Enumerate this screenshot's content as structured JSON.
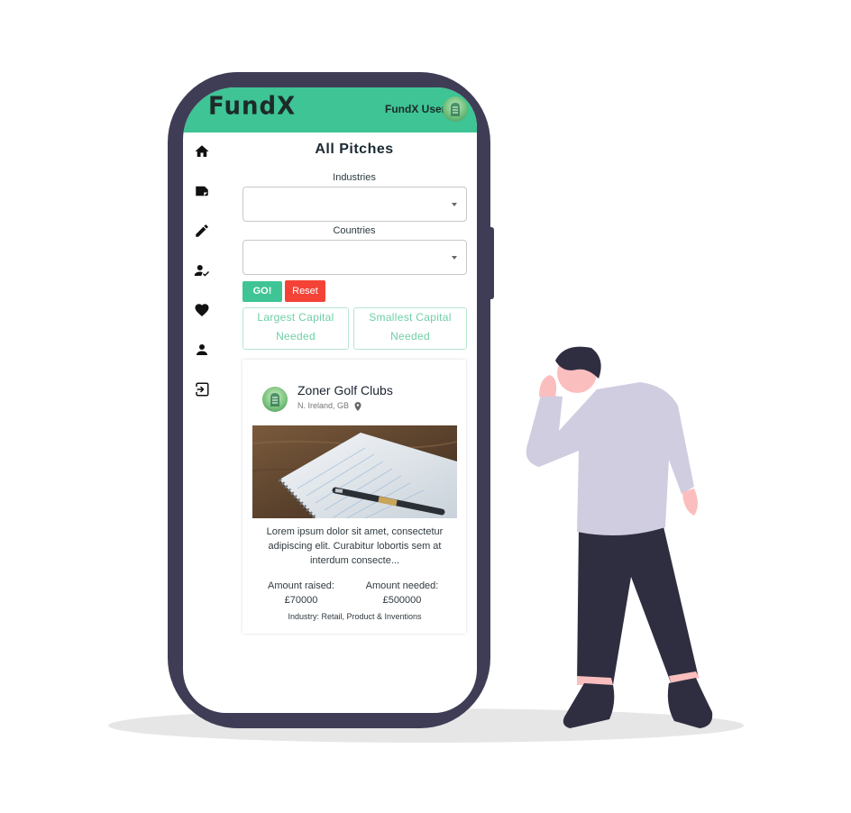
{
  "header": {
    "logo": "FundX",
    "user_name": "FundX User"
  },
  "sidebar": {
    "items": [
      {
        "name": "home-icon"
      },
      {
        "name": "label-icon"
      },
      {
        "name": "edit-icon"
      },
      {
        "name": "person-check-icon"
      },
      {
        "name": "heart-icon"
      },
      {
        "name": "person-icon"
      },
      {
        "name": "logout-icon"
      }
    ]
  },
  "main": {
    "title": "All Pitches",
    "filters": {
      "industries_label": "Industries",
      "industries_value": "",
      "countries_label": "Countries",
      "countries_value": ""
    },
    "buttons": {
      "go": "GO!",
      "reset": "Reset"
    },
    "sort": {
      "largest_line1": "Largest Capital",
      "largest_line2": "Needed",
      "smallest_line1": "Smallest Capital",
      "smallest_line2": "Needed"
    },
    "pitch": {
      "title": "Zoner Golf Clubs",
      "location": "N. Ireland, GB",
      "description": "Lorem ipsum dolor sit amet, consectetur adipiscing elit. Curabitur lobortis sem at interdum consecte...",
      "raised_label": "Amount raised:",
      "raised_value": "£70000",
      "needed_label": "Amount needed:",
      "needed_value": "£500000",
      "industry": "Industry: Retail, Product & Inventions"
    }
  },
  "colors": {
    "accent": "#3ec495",
    "danger": "#f44336",
    "device": "#3f3d56"
  }
}
